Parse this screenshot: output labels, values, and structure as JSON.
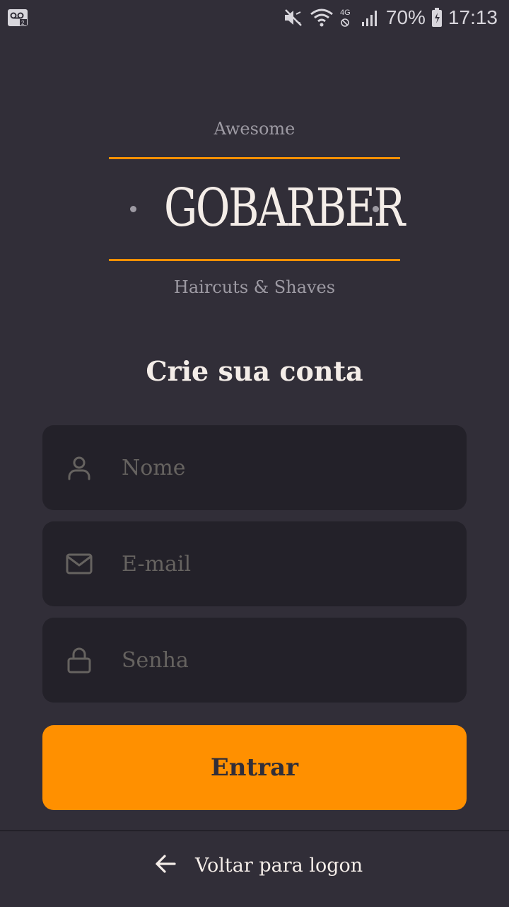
{
  "status_bar": {
    "battery": "70%",
    "time": "17:13",
    "network": "4G"
  },
  "logo": {
    "top": "Awesome",
    "word": "GOBARBER",
    "bottom": "Haircuts & Shaves",
    "accent": "#ff9000"
  },
  "page": {
    "title": "Crie sua conta"
  },
  "form": {
    "name_placeholder": "Nome",
    "email_placeholder": "E-mail",
    "password_placeholder": "Senha",
    "submit_label": "Entrar"
  },
  "footer": {
    "back_label": "Voltar para logon"
  },
  "icons": [
    "voicemail-icon",
    "mute-icon",
    "wifi-icon",
    "signal-icon",
    "battery-icon",
    "user-icon",
    "mail-icon",
    "lock-icon",
    "arrow-left-icon"
  ],
  "colors": {
    "background": "#312e38",
    "input_background": "#232129",
    "placeholder": "#666360",
    "text": "#f4ede8",
    "muted": "#9d9aa3"
  }
}
